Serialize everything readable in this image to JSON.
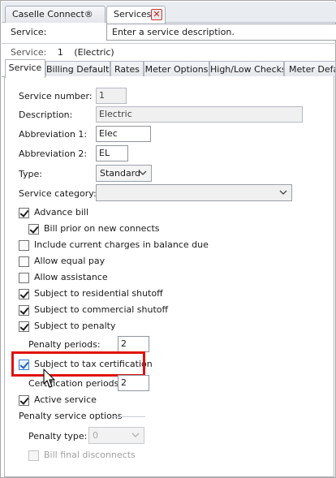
{
  "doc_tabs": [
    {
      "label": "Caselle Connect®"
    },
    {
      "label": "Services"
    }
  ],
  "header": {
    "service_label": "Service:",
    "description_placeholder": "Enter a service description.",
    "info_label": "Service:",
    "info_number": "1",
    "info_name": "(Electric)"
  },
  "tabs": [
    {
      "label": "Service",
      "active": true
    },
    {
      "label": "Billing Defaults"
    },
    {
      "label": "Rates"
    },
    {
      "label": "Meter Options"
    },
    {
      "label": "High/Low Checks"
    },
    {
      "label": "Meter Defaults"
    }
  ],
  "form": {
    "service_number_label": "Service number:",
    "service_number": "1",
    "description_label": "Description:",
    "description": "Electric",
    "abbrev1_label": "Abbreviation 1:",
    "abbrev1": "Elec",
    "abbrev2_label": "Abbreviation 2:",
    "abbrev2": "EL",
    "type_label": "Type:",
    "type_value": "Standard",
    "category_label": "Service category:",
    "category_value": ""
  },
  "checkboxes": {
    "advance_bill": {
      "label": "Advance bill",
      "checked": true
    },
    "bill_prior": {
      "label": "Bill prior on new connects",
      "checked": true
    },
    "include_current": {
      "label": "Include current charges in balance due",
      "checked": false
    },
    "equal_pay": {
      "label": "Allow equal pay",
      "checked": false
    },
    "assistance": {
      "label": "Allow assistance",
      "checked": false
    },
    "residential_shutoff": {
      "label": "Subject to residential shutoff",
      "checked": true
    },
    "commercial_shutoff": {
      "label": "Subject to commercial shutoff",
      "checked": true
    },
    "penalty": {
      "label": "Subject to penalty",
      "checked": true
    },
    "tax_cert": {
      "label": "Subject to tax certification",
      "checked": true
    },
    "active_service": {
      "label": "Active service",
      "checked": true
    },
    "bill_final": {
      "label": "Bill final disconnects",
      "checked": false
    }
  },
  "penalty_periods_label": "Penalty periods:",
  "penalty_periods": "2",
  "certification_periods_label": "Certification periods:",
  "certification_periods": "2",
  "penalty_options": {
    "group_label": "Penalty service options",
    "type_label": "Penalty type:",
    "type_value": "0"
  },
  "colors": {
    "highlight": "#e01010",
    "tab_close": "#cc2222"
  },
  "icons": [
    "close-icon",
    "chevron-down-icon",
    "checkmark-icon",
    "mouse-cursor-icon"
  ]
}
